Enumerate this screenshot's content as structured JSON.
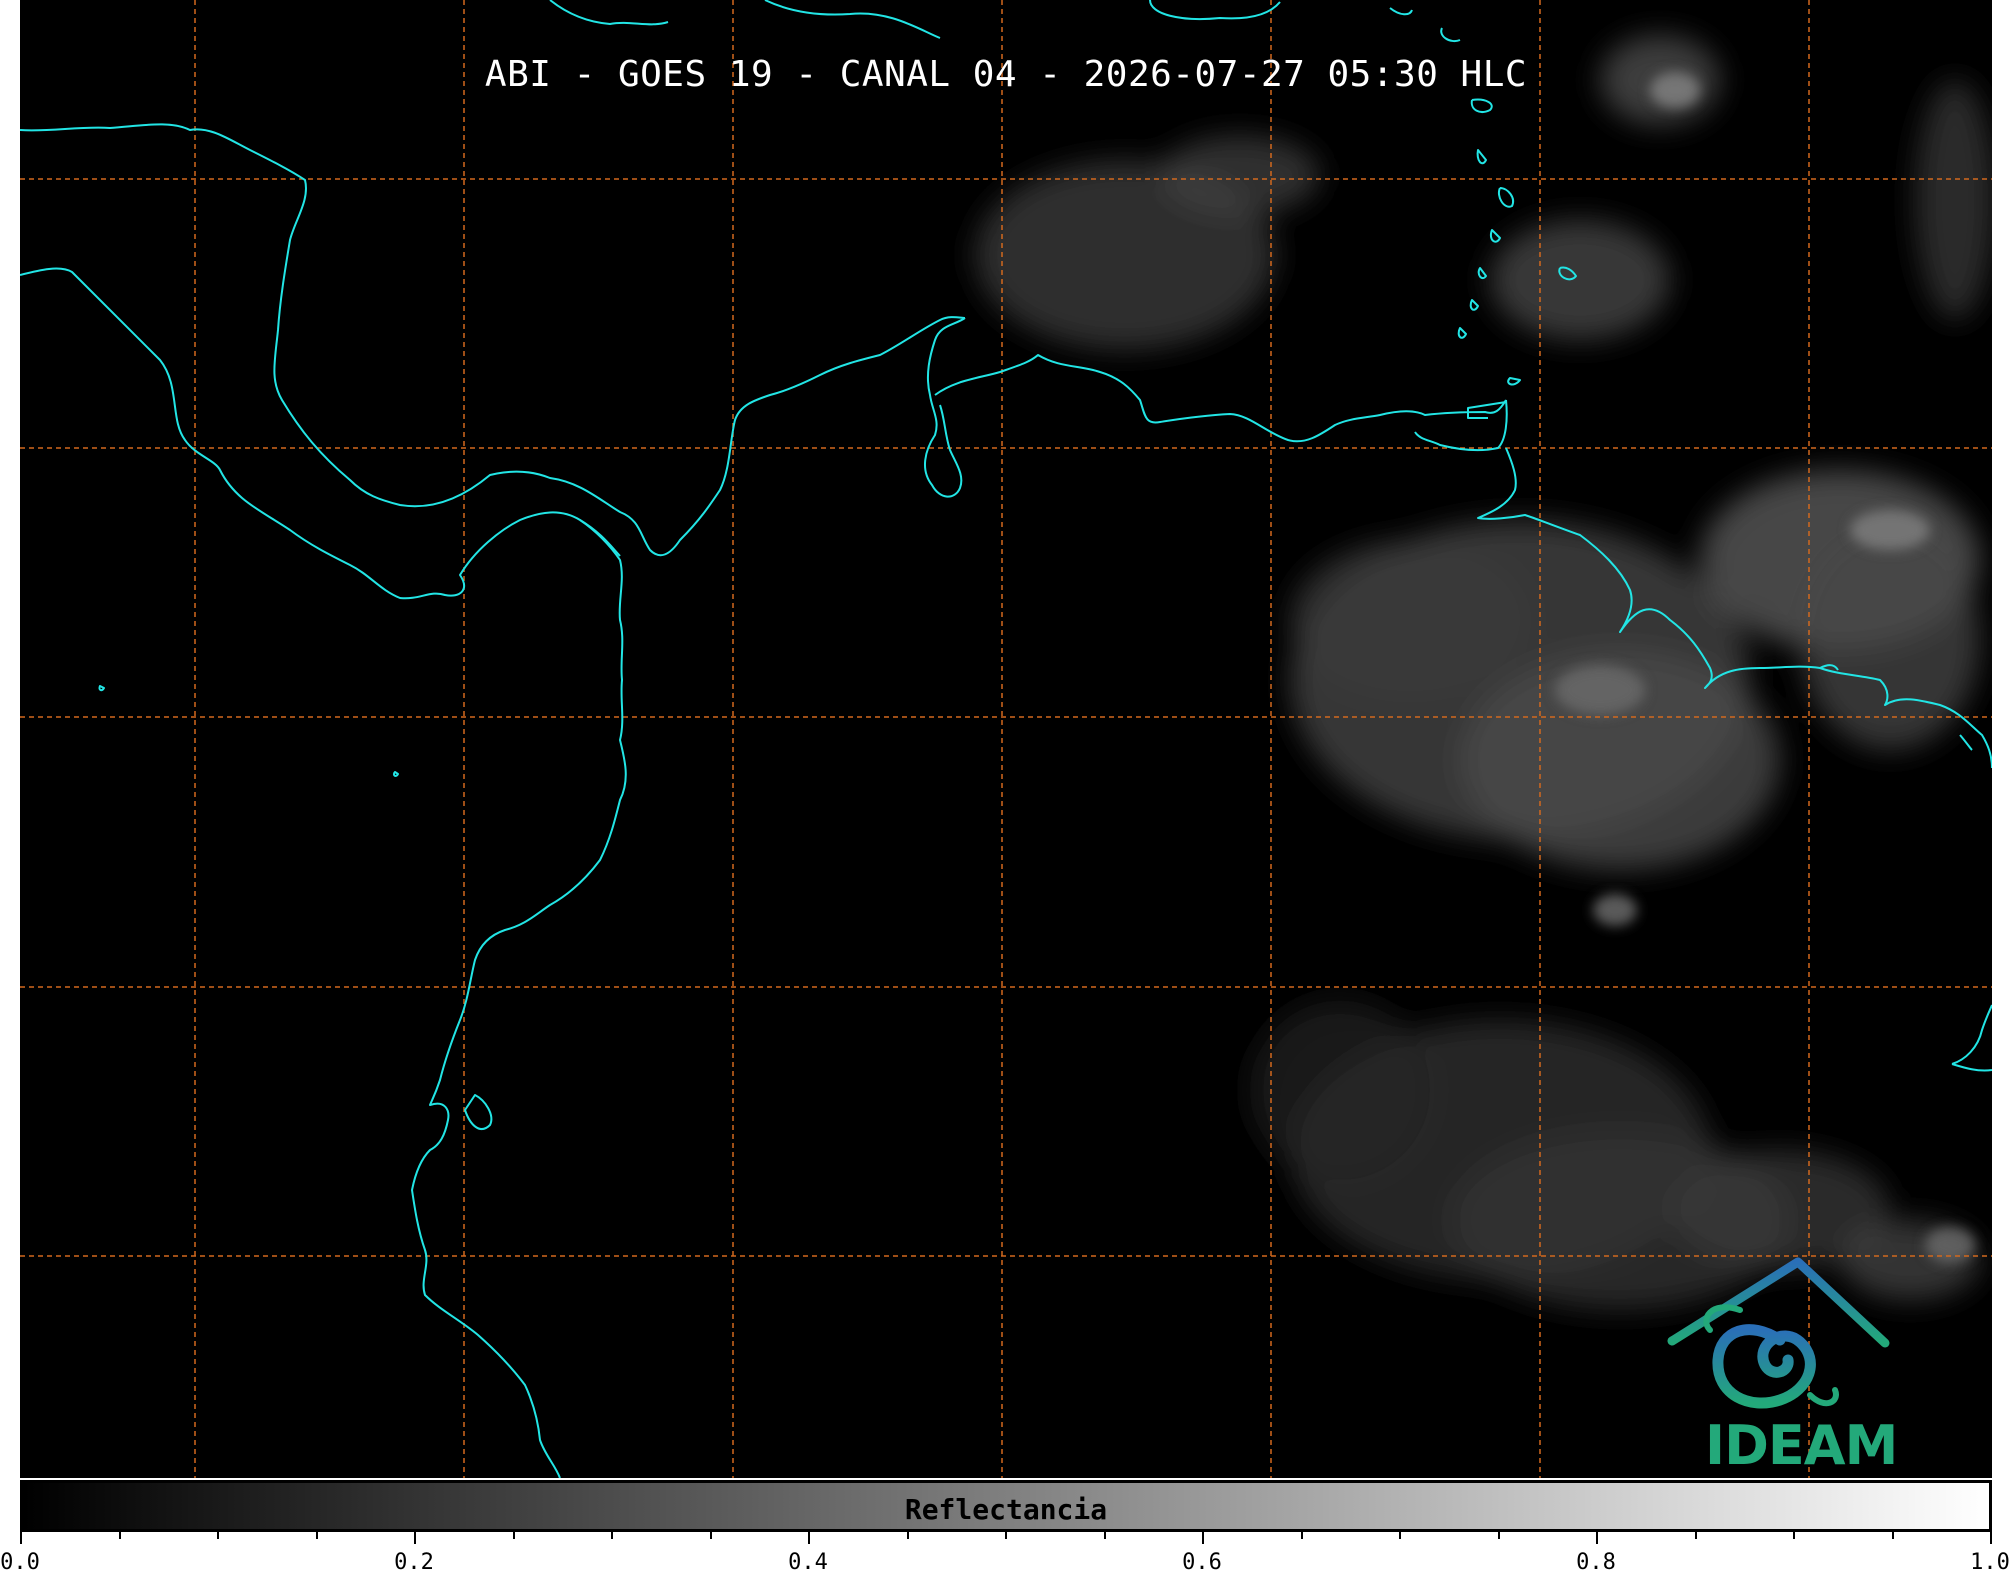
{
  "title": "ABI - GOES 19 - CANAL 04 - 2026-07-27 05:30 HLC",
  "colors": {
    "background": "#000000",
    "coastline": "#22e5e5",
    "gridline": "#d2691e",
    "cloud": "#9a9a9a",
    "logo_blue": "#2a7fb8",
    "logo_green": "#23a97a"
  },
  "logo": {
    "text": "IDEAM",
    "icon": "ideam-logo-icon"
  },
  "colorbar": {
    "label": "Reflectancia",
    "range": [
      0.0,
      1.0
    ],
    "cmap": "gray",
    "tick_labels": [
      "0.0",
      "0.2",
      "0.4",
      "0.6",
      "0.8",
      "1.0"
    ]
  },
  "map": {
    "gridlines": "dashed",
    "layers": [
      "visible-reflectance",
      "coastlines",
      "graticule"
    ]
  }
}
